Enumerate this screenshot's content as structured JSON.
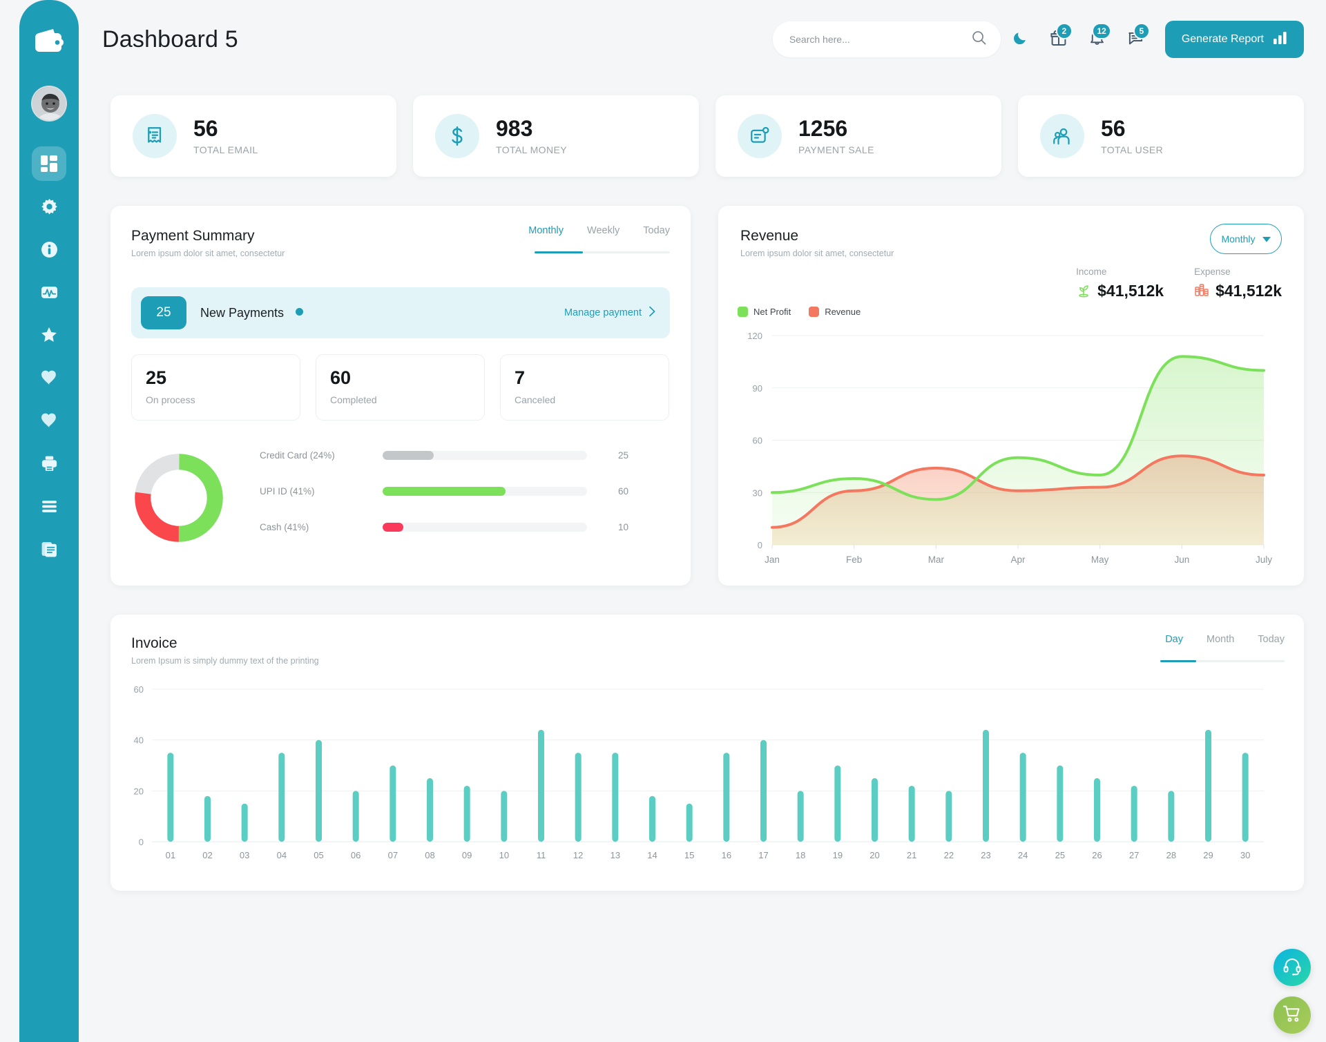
{
  "app": {
    "title": "Dashboard 5",
    "accent": "#1d9db6",
    "green": "#7ce05a",
    "orange": "#f4775f",
    "red": "#f93a5a",
    "gray": "#c4c7c9",
    "teal_bar": "#5bcdc2"
  },
  "sidebar": {
    "logo_icon": "wallet-icon",
    "avatar_name": "user-avatar",
    "items": [
      {
        "icon": "dashboard-grid-icon",
        "name": "dashboard",
        "active": true
      },
      {
        "icon": "gear-icon",
        "name": "settings",
        "active": false
      },
      {
        "icon": "info-icon",
        "name": "info",
        "active": false
      },
      {
        "icon": "activity-pulse-icon",
        "name": "analytics",
        "active": false
      },
      {
        "icon": "star-icon",
        "name": "favorites",
        "active": false
      },
      {
        "icon": "heart-icon",
        "name": "likes",
        "active": false
      },
      {
        "icon": "heart-icon",
        "name": "wishlist",
        "active": false
      },
      {
        "icon": "printer-icon",
        "name": "print",
        "active": false
      },
      {
        "icon": "menu-list-icon",
        "name": "lists",
        "active": false
      },
      {
        "icon": "document-icon",
        "name": "documents",
        "active": false
      }
    ]
  },
  "header": {
    "search_placeholder": "Search here...",
    "search_value": "",
    "search_icon": "search-icon",
    "dark_mode_icon": "moon-icon",
    "icons": [
      {
        "name": "gift-icon",
        "badge": "2"
      },
      {
        "name": "bell-icon",
        "badge": "12"
      },
      {
        "name": "message-icon",
        "badge": "5"
      }
    ],
    "generate_report_label": "Generate Report",
    "generate_report_icon": "bar-chart-icon"
  },
  "stats": [
    {
      "value": "56",
      "label": "TOTAL EMAIL",
      "icon": "receipt-icon"
    },
    {
      "value": "983",
      "label": "TOTAL MONEY",
      "icon": "dollar-icon"
    },
    {
      "value": "1256",
      "label": "PAYMENT SALE",
      "icon": "payment-card-icon"
    },
    {
      "value": "56",
      "label": "TOTAL USER",
      "icon": "users-icon"
    }
  ],
  "payment_summary": {
    "title": "Payment Summary",
    "subtitle": "Lorem ipsum dolor sit amet, consectetur",
    "tabs": [
      {
        "label": "Monthly",
        "active": true
      },
      {
        "label": "Weekly",
        "active": false
      },
      {
        "label": "Today",
        "active": false
      }
    ],
    "new_payments": {
      "count": "25",
      "label": "New Payments",
      "link": "Manage payment",
      "link_icon": "chevron-right-icon"
    },
    "mini_stats": [
      {
        "value": "25",
        "label": "On process"
      },
      {
        "value": "60",
        "label": "Completed"
      },
      {
        "value": "7",
        "label": "Canceled"
      }
    ],
    "methods": [
      {
        "name": "Credit Card (24%)",
        "value": "25",
        "pct": 25,
        "color": "#c4c7c9"
      },
      {
        "name": "UPI ID (41%)",
        "value": "60",
        "pct": 60,
        "color": "#7ce05a"
      },
      {
        "name": "Cash (41%)",
        "value": "10",
        "pct": 10,
        "color": "#f93a5a"
      }
    ],
    "donut": {
      "segments": [
        {
          "name": "UPI ID",
          "pct": 50,
          "color": "#7ce05a"
        },
        {
          "name": "Cash",
          "pct": 27,
          "color": "#f9474b"
        },
        {
          "name": "Credit Card",
          "pct": 23,
          "color": "#e0e2e3"
        }
      ]
    }
  },
  "revenue": {
    "title": "Revenue",
    "subtitle": "Lorem ipsum dolor sit amet, consectetur",
    "select_label": "Monthly",
    "select_icon": "caret-down-icon",
    "income_label": "Income",
    "income_value": "$41,512k",
    "income_icon": "money-plant-icon",
    "expense_label": "Expense",
    "expense_value": "$41,512k",
    "expense_icon": "money-stack-icon"
  },
  "invoice": {
    "title": "Invoice",
    "subtitle": "Lorem Ipsum is simply dummy text of the printing",
    "tabs": [
      {
        "label": "Day",
        "active": true
      },
      {
        "label": "Month",
        "active": false
      },
      {
        "label": "Today",
        "active": false
      }
    ]
  },
  "fabs": [
    {
      "name": "support-headset-icon",
      "label": "support"
    },
    {
      "name": "shopping-cart-icon",
      "label": "cart"
    }
  ],
  "chart_data": [
    {
      "type": "area",
      "title": "Revenue",
      "xlabel": "",
      "ylabel": "",
      "x": [
        "Jan",
        "Feb",
        "Mar",
        "Apr",
        "May",
        "Jun",
        "July"
      ],
      "yticks": [
        0,
        30,
        60,
        90,
        120
      ],
      "ylim": [
        0,
        120
      ],
      "grid": true,
      "legend_position": "top-left",
      "series": [
        {
          "name": "Net Profit",
          "color": "#7ce05a",
          "values": [
            30,
            38,
            26,
            50,
            40,
            108,
            100
          ]
        },
        {
          "name": "Revenue",
          "color": "#f4775f",
          "values": [
            10,
            31,
            44,
            31,
            33,
            51,
            40
          ]
        }
      ]
    },
    {
      "type": "bar",
      "title": "Invoice",
      "xlabel": "",
      "ylabel": "",
      "categories": [
        "01",
        "02",
        "03",
        "04",
        "05",
        "06",
        "07",
        "08",
        "09",
        "10",
        "11",
        "12",
        "13",
        "14",
        "15",
        "16",
        "17",
        "18",
        "19",
        "20",
        "21",
        "22",
        "23",
        "24",
        "25",
        "26",
        "27",
        "28",
        "29",
        "30"
      ],
      "values": [
        35,
        18,
        15,
        35,
        40,
        20,
        30,
        25,
        22,
        20,
        44,
        35,
        35,
        18,
        15,
        35,
        40,
        20,
        30,
        25,
        22,
        20,
        44,
        35,
        30,
        25,
        22,
        20,
        44,
        35
      ],
      "yticks": [
        0,
        20,
        40,
        60
      ],
      "ylim": [
        0,
        60
      ],
      "grid": true,
      "color": "#5bcdc2"
    }
  ]
}
